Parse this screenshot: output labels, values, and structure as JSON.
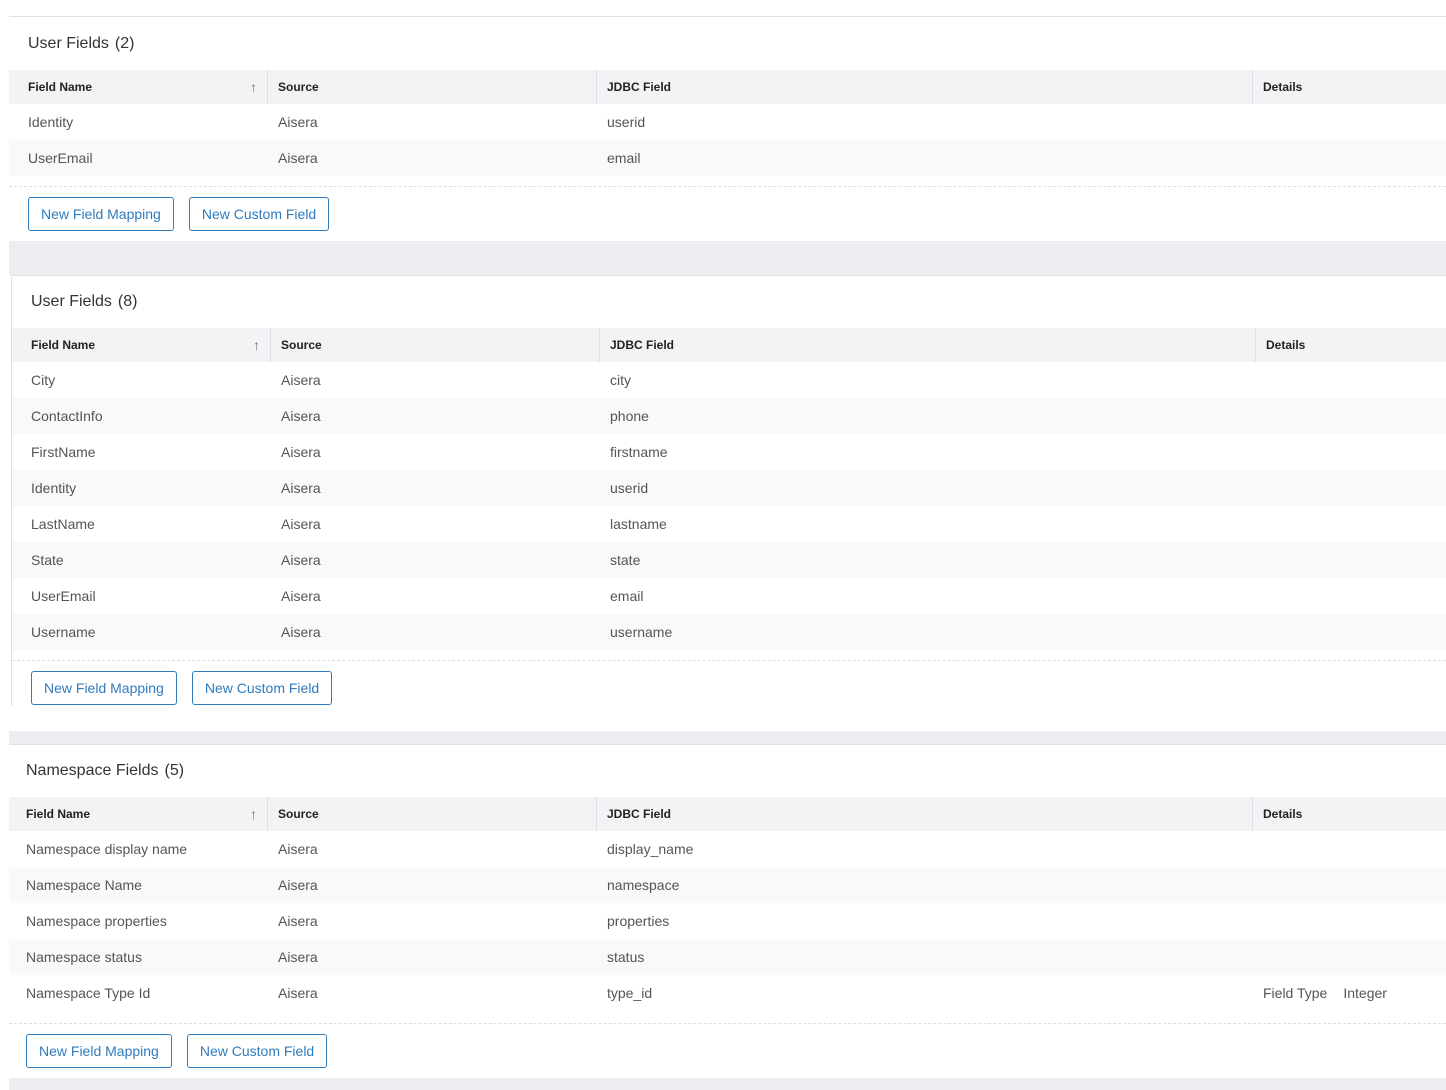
{
  "columns": {
    "field_name": "Field Name",
    "source": "Source",
    "jdbc_field": "JDBC Field",
    "details": "Details",
    "sort_icon": "arrow-up-icon"
  },
  "buttons": {
    "new_field_mapping": "New Field Mapping",
    "new_custom_field": "New Custom Field"
  },
  "sections": [
    {
      "title": "User Fields",
      "count": "(2)",
      "rows": [
        {
          "field": "Identity",
          "source": "Aisera",
          "jdbc": "userid",
          "details_key": "",
          "details_value": ""
        },
        {
          "field": "UserEmail",
          "source": "Aisera",
          "jdbc": "email",
          "details_key": "",
          "details_value": ""
        }
      ]
    },
    {
      "title": "User Fields",
      "count": "(8)",
      "rows": [
        {
          "field": "City",
          "source": "Aisera",
          "jdbc": "city",
          "details_key": "",
          "details_value": ""
        },
        {
          "field": "ContactInfo",
          "source": "Aisera",
          "jdbc": "phone",
          "details_key": "",
          "details_value": ""
        },
        {
          "field": "FirstName",
          "source": "Aisera",
          "jdbc": "firstname",
          "details_key": "",
          "details_value": ""
        },
        {
          "field": "Identity",
          "source": "Aisera",
          "jdbc": "userid",
          "details_key": "",
          "details_value": ""
        },
        {
          "field": "LastName",
          "source": "Aisera",
          "jdbc": "lastname",
          "details_key": "",
          "details_value": ""
        },
        {
          "field": "State",
          "source": "Aisera",
          "jdbc": "state",
          "details_key": "",
          "details_value": ""
        },
        {
          "field": "UserEmail",
          "source": "Aisera",
          "jdbc": "email",
          "details_key": "",
          "details_value": ""
        },
        {
          "field": "Username",
          "source": "Aisera",
          "jdbc": "username",
          "details_key": "",
          "details_value": ""
        }
      ]
    },
    {
      "title": "Namespace Fields",
      "count": "(5)",
      "rows": [
        {
          "field": "Namespace display name",
          "source": "Aisera",
          "jdbc": "display_name",
          "details_key": "",
          "details_value": ""
        },
        {
          "field": "Namespace Name",
          "source": "Aisera",
          "jdbc": "namespace",
          "details_key": "",
          "details_value": ""
        },
        {
          "field": "Namespace properties",
          "source": "Aisera",
          "jdbc": "properties",
          "details_key": "",
          "details_value": ""
        },
        {
          "field": "Namespace status",
          "source": "Aisera",
          "jdbc": "status",
          "details_key": "",
          "details_value": ""
        },
        {
          "field": "Namespace Type Id",
          "source": "Aisera",
          "jdbc": "type_id",
          "details_key": "Field Type",
          "details_value": "Integer"
        }
      ]
    }
  ]
}
